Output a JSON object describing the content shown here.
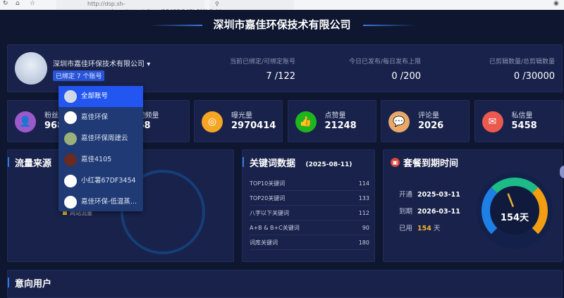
{
  "browser": {
    "url": "http://dsp.sh-seo.com/user/report_form/13433/148b3f4b6abl"
  },
  "page_title": "深圳市嘉佳环保技术有限公司",
  "header": {
    "company": "深圳市嘉佳环保技术有限公司",
    "bound_badge": "已绑定 7 个账号",
    "stats": [
      {
        "label": "当前已绑定/可绑定账号",
        "value": "7 /122"
      },
      {
        "label": "今日已发布/每日发布上限",
        "value": "0 /200"
      },
      {
        "label": "已剪辑数量/总剪辑数量",
        "value": "0 /30000"
      }
    ]
  },
  "stats": [
    {
      "label": "粉丝量",
      "value": "968",
      "color": "#9b59c9",
      "icon": "user-icon"
    },
    {
      "label": "视频量",
      "value": "68",
      "color": "#2b7be0",
      "icon": "video-icon"
    },
    {
      "label": "曝光量",
      "value": "2970414",
      "color": "#f5a623",
      "icon": "aperture-icon"
    },
    {
      "label": "点赞量",
      "value": "21248",
      "color": "#1fb51f",
      "icon": "thumbs-up-icon"
    },
    {
      "label": "评论量",
      "value": "2026",
      "color": "#e8a86a",
      "icon": "comment-icon"
    },
    {
      "label": "私信量",
      "value": "5458",
      "color": "#ec5a4f",
      "icon": "mail-icon"
    }
  ],
  "traffic": {
    "title": "流量来源",
    "legend": "网站流量"
  },
  "keywords": {
    "title": "关键词数据",
    "date": "(2025-08-11)",
    "rows": [
      {
        "label": "TOP10关键词",
        "value": "114"
      },
      {
        "label": "TOP20关键词",
        "value": "133"
      },
      {
        "label": "八字以下关键词",
        "value": "112"
      },
      {
        "label": "A+B & B+C关键词",
        "value": "90"
      },
      {
        "label": "词库关键词",
        "value": "180"
      }
    ]
  },
  "plan": {
    "title": "套餐到期时间",
    "start_label": "开通",
    "start": "2025-03-11",
    "end_label": "到期",
    "end": "2026-03-11",
    "used_label": "已用",
    "used": "154",
    "used_unit": "天",
    "gauge_text": "154天",
    "used_days": 154,
    "total_days": 365
  },
  "intent": {
    "title": "意向用户"
  },
  "dropdown": {
    "items": [
      "全部账号",
      "嘉佳环保",
      "嘉佳环保周建云",
      "嘉佳4105",
      "小红薯67DF3454",
      "嘉佳环保-低温蒸..."
    ],
    "selected": 0
  }
}
